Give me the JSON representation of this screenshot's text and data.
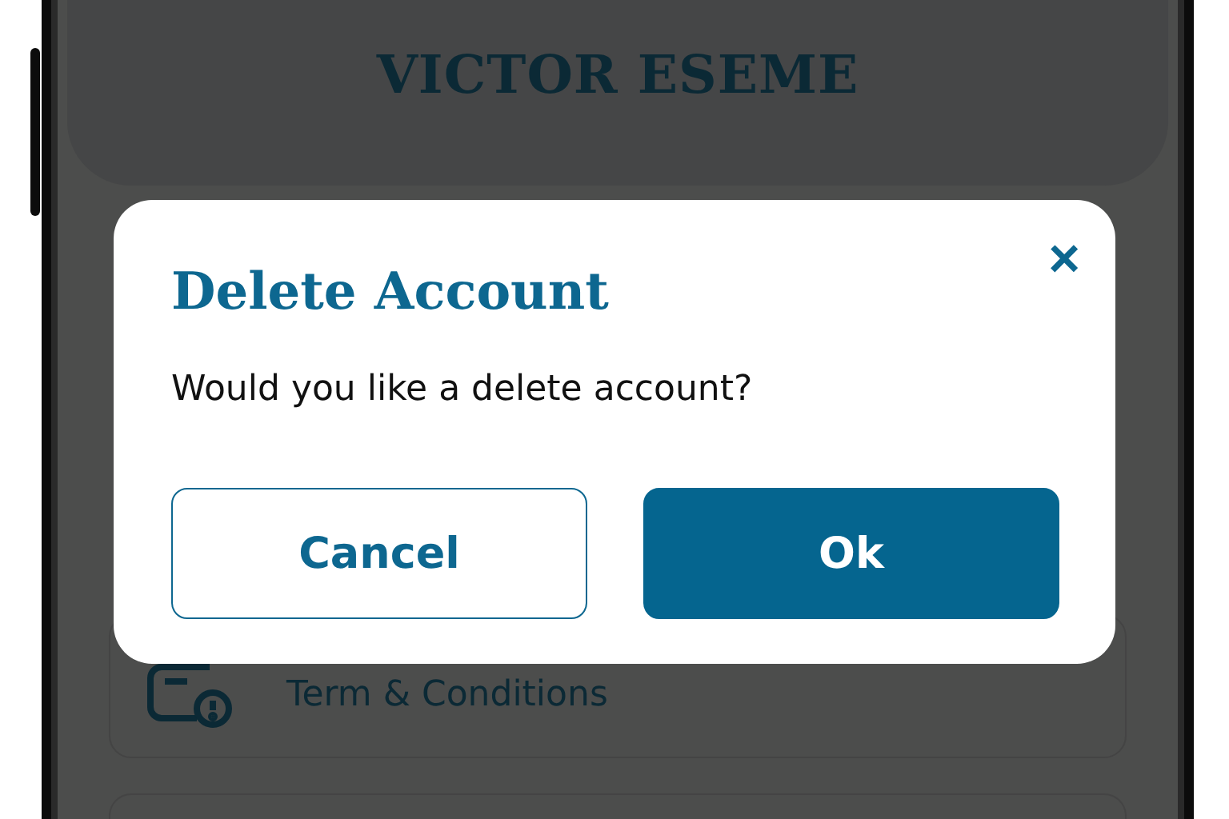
{
  "header": {
    "title": "VICTOR ESEME"
  },
  "menu_items": [
    {
      "label": "Term & Conditions"
    }
  ],
  "dialog": {
    "title": "Delete Account",
    "close": "×",
    "message": "Would you like a delete account?",
    "buttons": [
      {
        "label": "Cancel",
        "kind": "secondary"
      },
      {
        "label": "Ok",
        "kind": "primary"
      }
    ]
  }
}
